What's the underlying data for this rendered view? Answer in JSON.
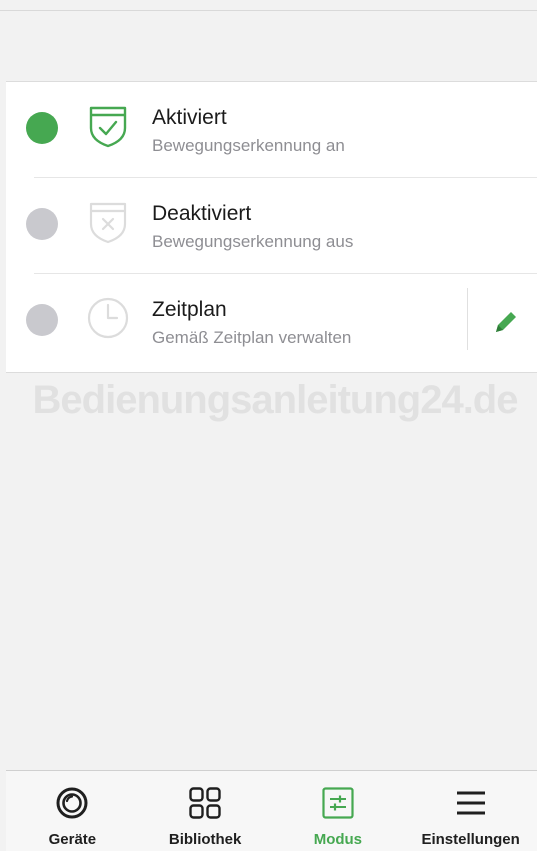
{
  "colors": {
    "accent": "#46a851",
    "inactive": "#c9c9ce"
  },
  "modes": [
    {
      "title": "Aktiviert",
      "subtitle": "Bewegungserkennung an",
      "selected": true,
      "icon": "shield-check-icon"
    },
    {
      "title": "Deaktiviert",
      "subtitle": "Bewegungserkennung aus",
      "selected": false,
      "icon": "shield-x-icon"
    },
    {
      "title": "Zeitplan",
      "subtitle": "Gemäß Zeitplan verwalten",
      "selected": false,
      "icon": "clock-icon",
      "action_icon": "pencil-icon"
    }
  ],
  "watermark": "Bedienungsanleitung24.de",
  "tabs": [
    {
      "label": "Geräte",
      "icon": "camera-lens-icon",
      "active": false
    },
    {
      "label": "Bibliothek",
      "icon": "grid-icon",
      "active": false
    },
    {
      "label": "Modus",
      "icon": "sliders-icon",
      "active": true
    },
    {
      "label": "Einstellungen",
      "icon": "menu-icon",
      "active": false
    }
  ]
}
